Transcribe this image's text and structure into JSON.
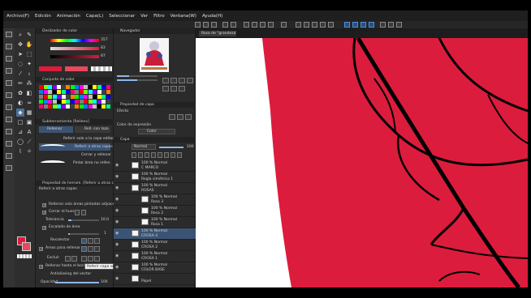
{
  "menu": [
    "Archivo(F)",
    "Edición",
    "Animación",
    "Capa(L)",
    "Seleccionar",
    "Ver",
    "Filtro",
    "Ventana(W)",
    "Ayuda(H)"
  ],
  "colors": {
    "main": "#dc1c3c",
    "sub": "#e8495e",
    "accent": "#4a8fd9"
  },
  "color_slider": {
    "title": "Deslizador de color",
    "rows": [
      {
        "label": "R",
        "value": "357"
      },
      {
        "label": "S",
        "value": "83"
      },
      {
        "label": "V",
        "value": "87"
      }
    ]
  },
  "color_set": {
    "title": "Conjunto de color"
  },
  "subtool": {
    "title": "Subherramienta [Relleno]",
    "tab_left": "Rellenar",
    "tab_right": "Rell. con lazo",
    "items": [
      "Referir solo a la capa editada",
      "Referir a otras capas",
      "Cerrar y rellenar",
      "Pintar área no rellenada"
    ]
  },
  "tool_props": {
    "title": "Propiedad de herram. [Referir a otras capas]",
    "name": "Referir a otras capas",
    "opts": [
      {
        "label": "Rellenar solo áreas pintadas adyacentes",
        "checked": true
      },
      {
        "label": "Cerrar el hueco",
        "checked": true
      },
      {
        "label": "Tolerancia",
        "value": "10.0",
        "checked": false
      },
      {
        "label": "Escalado de área",
        "value": "1",
        "checked": true
      },
      {
        "label": "Recolectar",
        "value": "",
        "checked": false
      },
      {
        "label": "Áreas para rellenar",
        "value": "",
        "checked": true
      },
      {
        "label": "Excluir",
        "value": "",
        "checked": false
      },
      {
        "label": "Rellenar hasta el borde",
        "value": "",
        "checked": true
      },
      {
        "label": "Antialiasing del vector",
        "value": "",
        "checked": false
      },
      {
        "label": "Opacidad",
        "value": "100",
        "checked": false
      }
    ],
    "tooltip": "Referir capa seleccionada"
  },
  "navigator": {
    "title": "Navegador"
  },
  "layer_props": {
    "title": "Propiedad de capa",
    "effect": "Efecto"
  },
  "color_expr": {
    "title": "Color de expresión",
    "value": "Color"
  },
  "layers": {
    "title": "Capa",
    "blend": "Normal",
    "opacity": "100",
    "rows": [
      {
        "pct": "100 % Normal",
        "name": "C MARCO",
        "sel": false
      },
      {
        "pct": "100 % Normal",
        "name": "Regla simétrica 1",
        "sel": false
      },
      {
        "pct": "100 % Normal",
        "name": "ROSAS",
        "sel": false
      },
      {
        "pct": "100 % Normal",
        "name": "Rosa 3",
        "sel": false
      },
      {
        "pct": "100 % Normal",
        "name": "Rosa 2",
        "sel": false
      },
      {
        "pct": "100 % Normal",
        "name": "Rosa 1",
        "sel": false
      },
      {
        "pct": "100 % Normal",
        "name": "CROSA 4",
        "sel": true
      },
      {
        "pct": "100 % Normal",
        "name": "CROSA 2",
        "sel": false
      },
      {
        "pct": "100 % Normal",
        "name": "CROSA 1",
        "sel": false
      },
      {
        "pct": "100 % Normal",
        "name": "COLOR BASE",
        "sel": false
      },
      {
        "pct": "",
        "name": "Papel",
        "sel": false
      }
    ]
  },
  "canvas": {
    "tab": "Rosa de \"grandeza\""
  }
}
